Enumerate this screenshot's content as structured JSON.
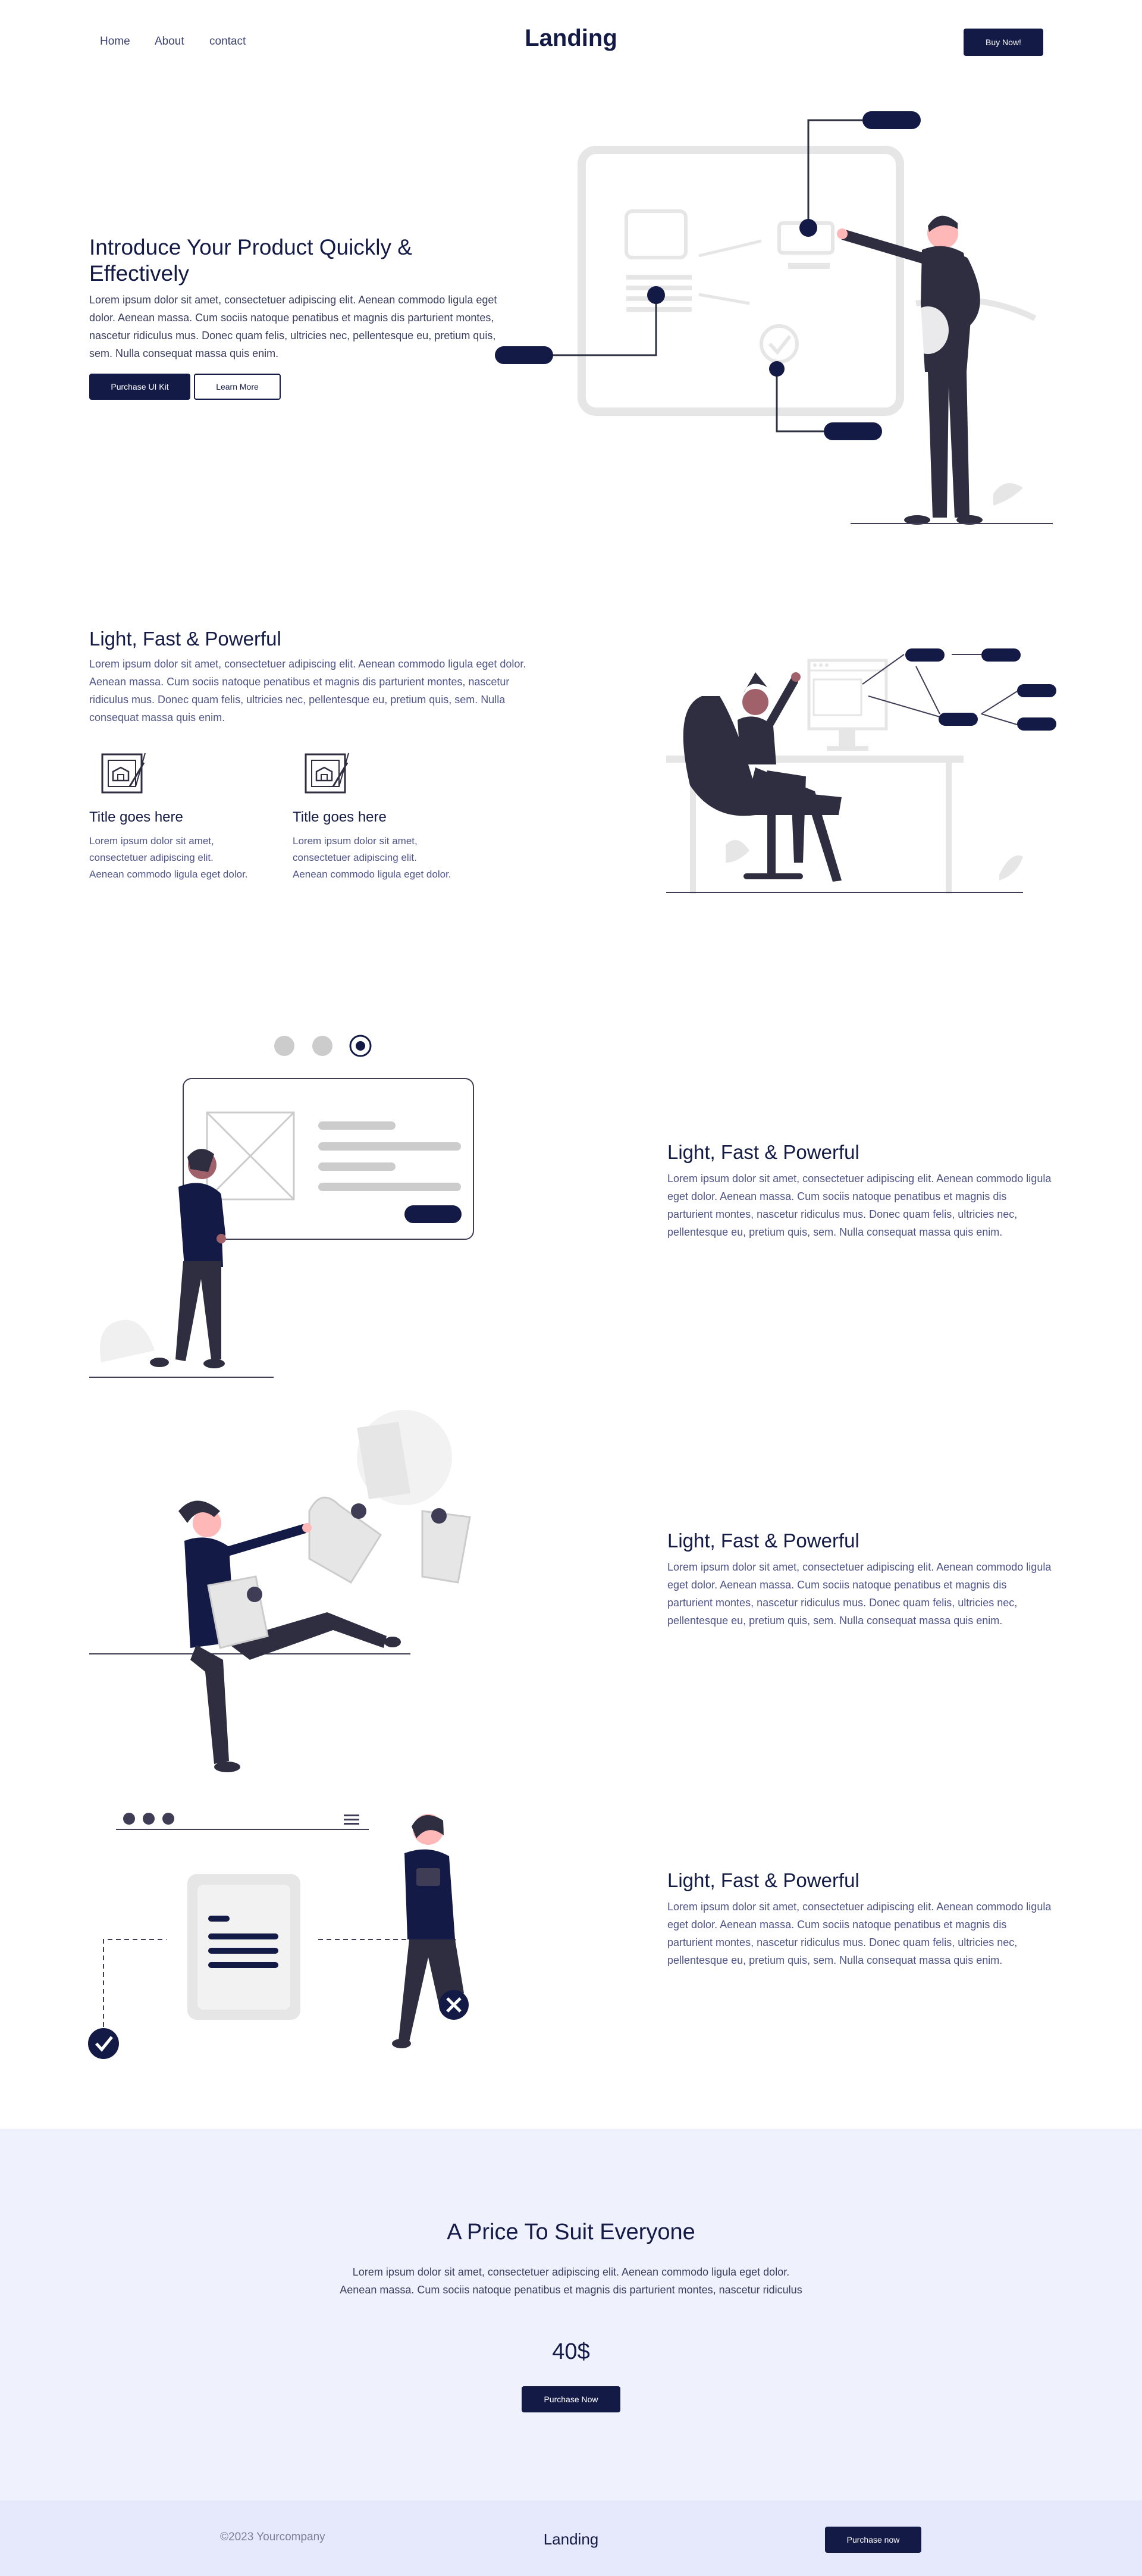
{
  "header": {
    "nav": [
      {
        "label": "Home"
      },
      {
        "label": "About"
      },
      {
        "label": "contact"
      }
    ],
    "logo": "Landing",
    "cta": "Buy Now!"
  },
  "hero": {
    "title": "Introduce Your Product Quickly & Effectively",
    "text": "Lorem ipsum dolor sit amet, consectetuer adipiscing elit. Aenean commodo ligula eget dolor. Aenean massa. Cum sociis natoque penatibus et magnis dis parturient montes, nascetur ridiculus mus. Donec quam felis, ultricies nec, pellentesque eu, pretium quis, sem. Nulla consequat massa quis enim.",
    "primary_button": "Purchase UI Kit",
    "secondary_button": "Learn More"
  },
  "features": {
    "title": "Light, Fast & Powerful",
    "text": "Lorem ipsum dolor sit amet, consectetuer adipiscing elit. Aenean commodo ligula eget dolor. Aenean massa. Cum sociis natoque penatibus et magnis dis parturient montes, nascetur ridiculus mus. Donec quam felis, ultricies nec, pellentesque eu, pretium quis, sem. Nulla consequat massa quis enim.",
    "items": [
      {
        "title": "Title goes here",
        "text": "Lorem ipsum dolor sit amet, consectetuer adipiscing elit. Aenean commodo ligula eget dolor.",
        "icon": "blueprint-icon"
      },
      {
        "title": "Title goes here",
        "text": "Lorem ipsum dolor sit amet, consectetuer adipiscing elit. Aenean commodo ligula eget dolor.",
        "icon": "blueprint-icon"
      }
    ]
  },
  "rows": [
    {
      "title": "Light, Fast & Powerful",
      "text": "Lorem ipsum dolor sit amet, consectetuer adipiscing elit. Aenean commodo ligula eget dolor. Aenean massa. Cum sociis natoque penatibus et magnis dis parturient montes, nascetur ridiculus mus. Donec quam felis, ultricies nec, pellentesque eu, pretium quis, sem. Nulla consequat massa quis enim."
    },
    {
      "title": "Light, Fast & Powerful",
      "text": "Lorem ipsum dolor sit amet, consectetuer adipiscing elit. Aenean commodo ligula eget dolor. Aenean massa. Cum sociis natoque penatibus et magnis dis parturient montes, nascetur ridiculus mus. Donec quam felis, ultricies nec, pellentesque eu, pretium quis, sem. Nulla consequat massa quis enim."
    },
    {
      "title": "Light, Fast & Powerful",
      "text": "Lorem ipsum dolor sit amet, consectetuer adipiscing elit. Aenean commodo ligula eget dolor. Aenean massa. Cum sociis natoque penatibus et magnis dis parturient montes, nascetur ridiculus mus. Donec quam felis, ultricies nec, pellentesque eu, pretium quis, sem. Nulla consequat massa quis enim."
    }
  ],
  "pricing": {
    "title": "A Price To Suit Everyone",
    "text": "Lorem ipsum dolor sit amet, consectetuer adipiscing elit. Aenean commodo ligula eget dolor. Aenean massa. Cum sociis natoque penatibus et magnis dis parturient montes, nascetur ridiculus",
    "price": "40$",
    "button": "Purchase Now"
  },
  "footer": {
    "copyright": "©2023 Yourcompany",
    "logo": "Landing",
    "button": "Purchase now"
  },
  "colors": {
    "navy": "#141a46",
    "pricing_bg": "#eff1fd",
    "footer_bg": "#e6e8fb",
    "illustration_gray": "#e6e6e6"
  }
}
